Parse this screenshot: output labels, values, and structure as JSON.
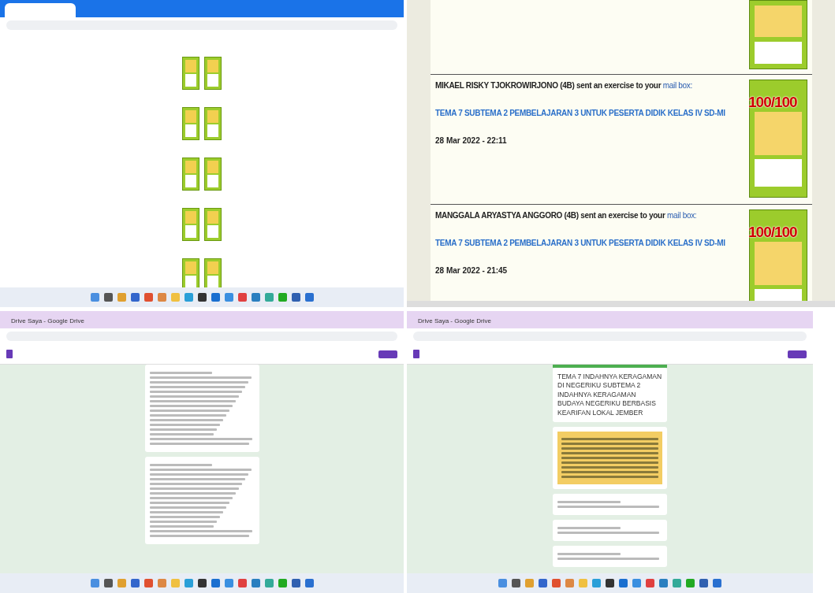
{
  "mail_feed": {
    "entries": [
      {
        "sender": "MIKAEL RISKY TJOKROWIRJONO (4B) sent an exercise to your",
        "link": "mail box:",
        "title": "TEMA 7 SUBTEMA 2 PEMBELAJARAN 3 UNTUK PESERTA DIDIK KELAS IV SD-MI",
        "date": "28 Mar 2022 - 22:11",
        "score": "100/100"
      },
      {
        "sender": "MANGGALA ARYASTYA ANGGORO (4B) sent an exercise to your",
        "link": "mail box:",
        "title": "TEMA 7 SUBTEMA 2 PEMBELAJARAN 3 UNTUK PESERTA DIDIK KELAS IV SD-MI",
        "date": "28 Mar 2022 - 21:45",
        "score": "100/100"
      }
    ]
  },
  "form_windows": [
    {
      "tabs": [
        {
          "label": "Drive Saya - Google Drive",
          "selected": false
        }
      ]
    },
    {
      "tabs": [
        {
          "label": "Drive Saya - Google Drive",
          "selected": false
        }
      ],
      "form_title": "TEMA 7 INDAHNYA KERAGAMAN DI NEGERIKU SUBTEMA 2 INDAHNYA KERAGAMAN BUDAYA NEGERIKU BERBASIS KEARIFAN LOKAL JEMBER"
    }
  ]
}
